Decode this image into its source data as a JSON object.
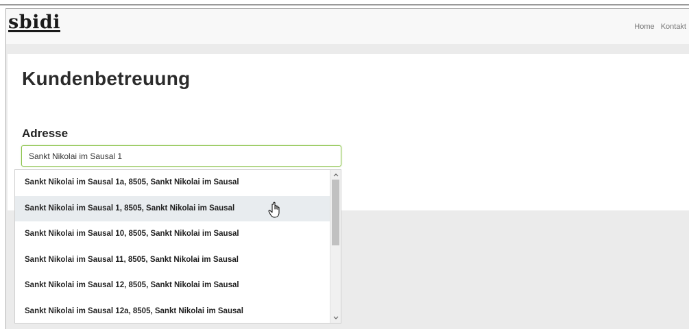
{
  "brand": "sbidi",
  "nav": {
    "links": [
      "Home",
      "Kontakt"
    ]
  },
  "page": {
    "title": "Kundenbetreuung"
  },
  "form": {
    "address_label": "Adresse",
    "address_value": "Sankt Nikolai im Sausal 1"
  },
  "suggestions": [
    "Sankt Nikolai im Sausal 1a, 8505, Sankt Nikolai im Sausal",
    "Sankt Nikolai im Sausal 1, 8505, Sankt Nikolai im Sausal",
    "Sankt Nikolai im Sausal 10, 8505, Sankt Nikolai im Sausal",
    "Sankt Nikolai im Sausal 11, 8505, Sankt Nikolai im Sausal",
    "Sankt Nikolai im Sausal 12, 8505, Sankt Nikolai im Sausal",
    "Sankt Nikolai im Sausal 12a, 8505, Sankt Nikolai im Sausal"
  ],
  "highlighted_index": 1,
  "colors": {
    "input_focus_border": "#8bc34a",
    "highlight_row": "#e8ecef"
  }
}
